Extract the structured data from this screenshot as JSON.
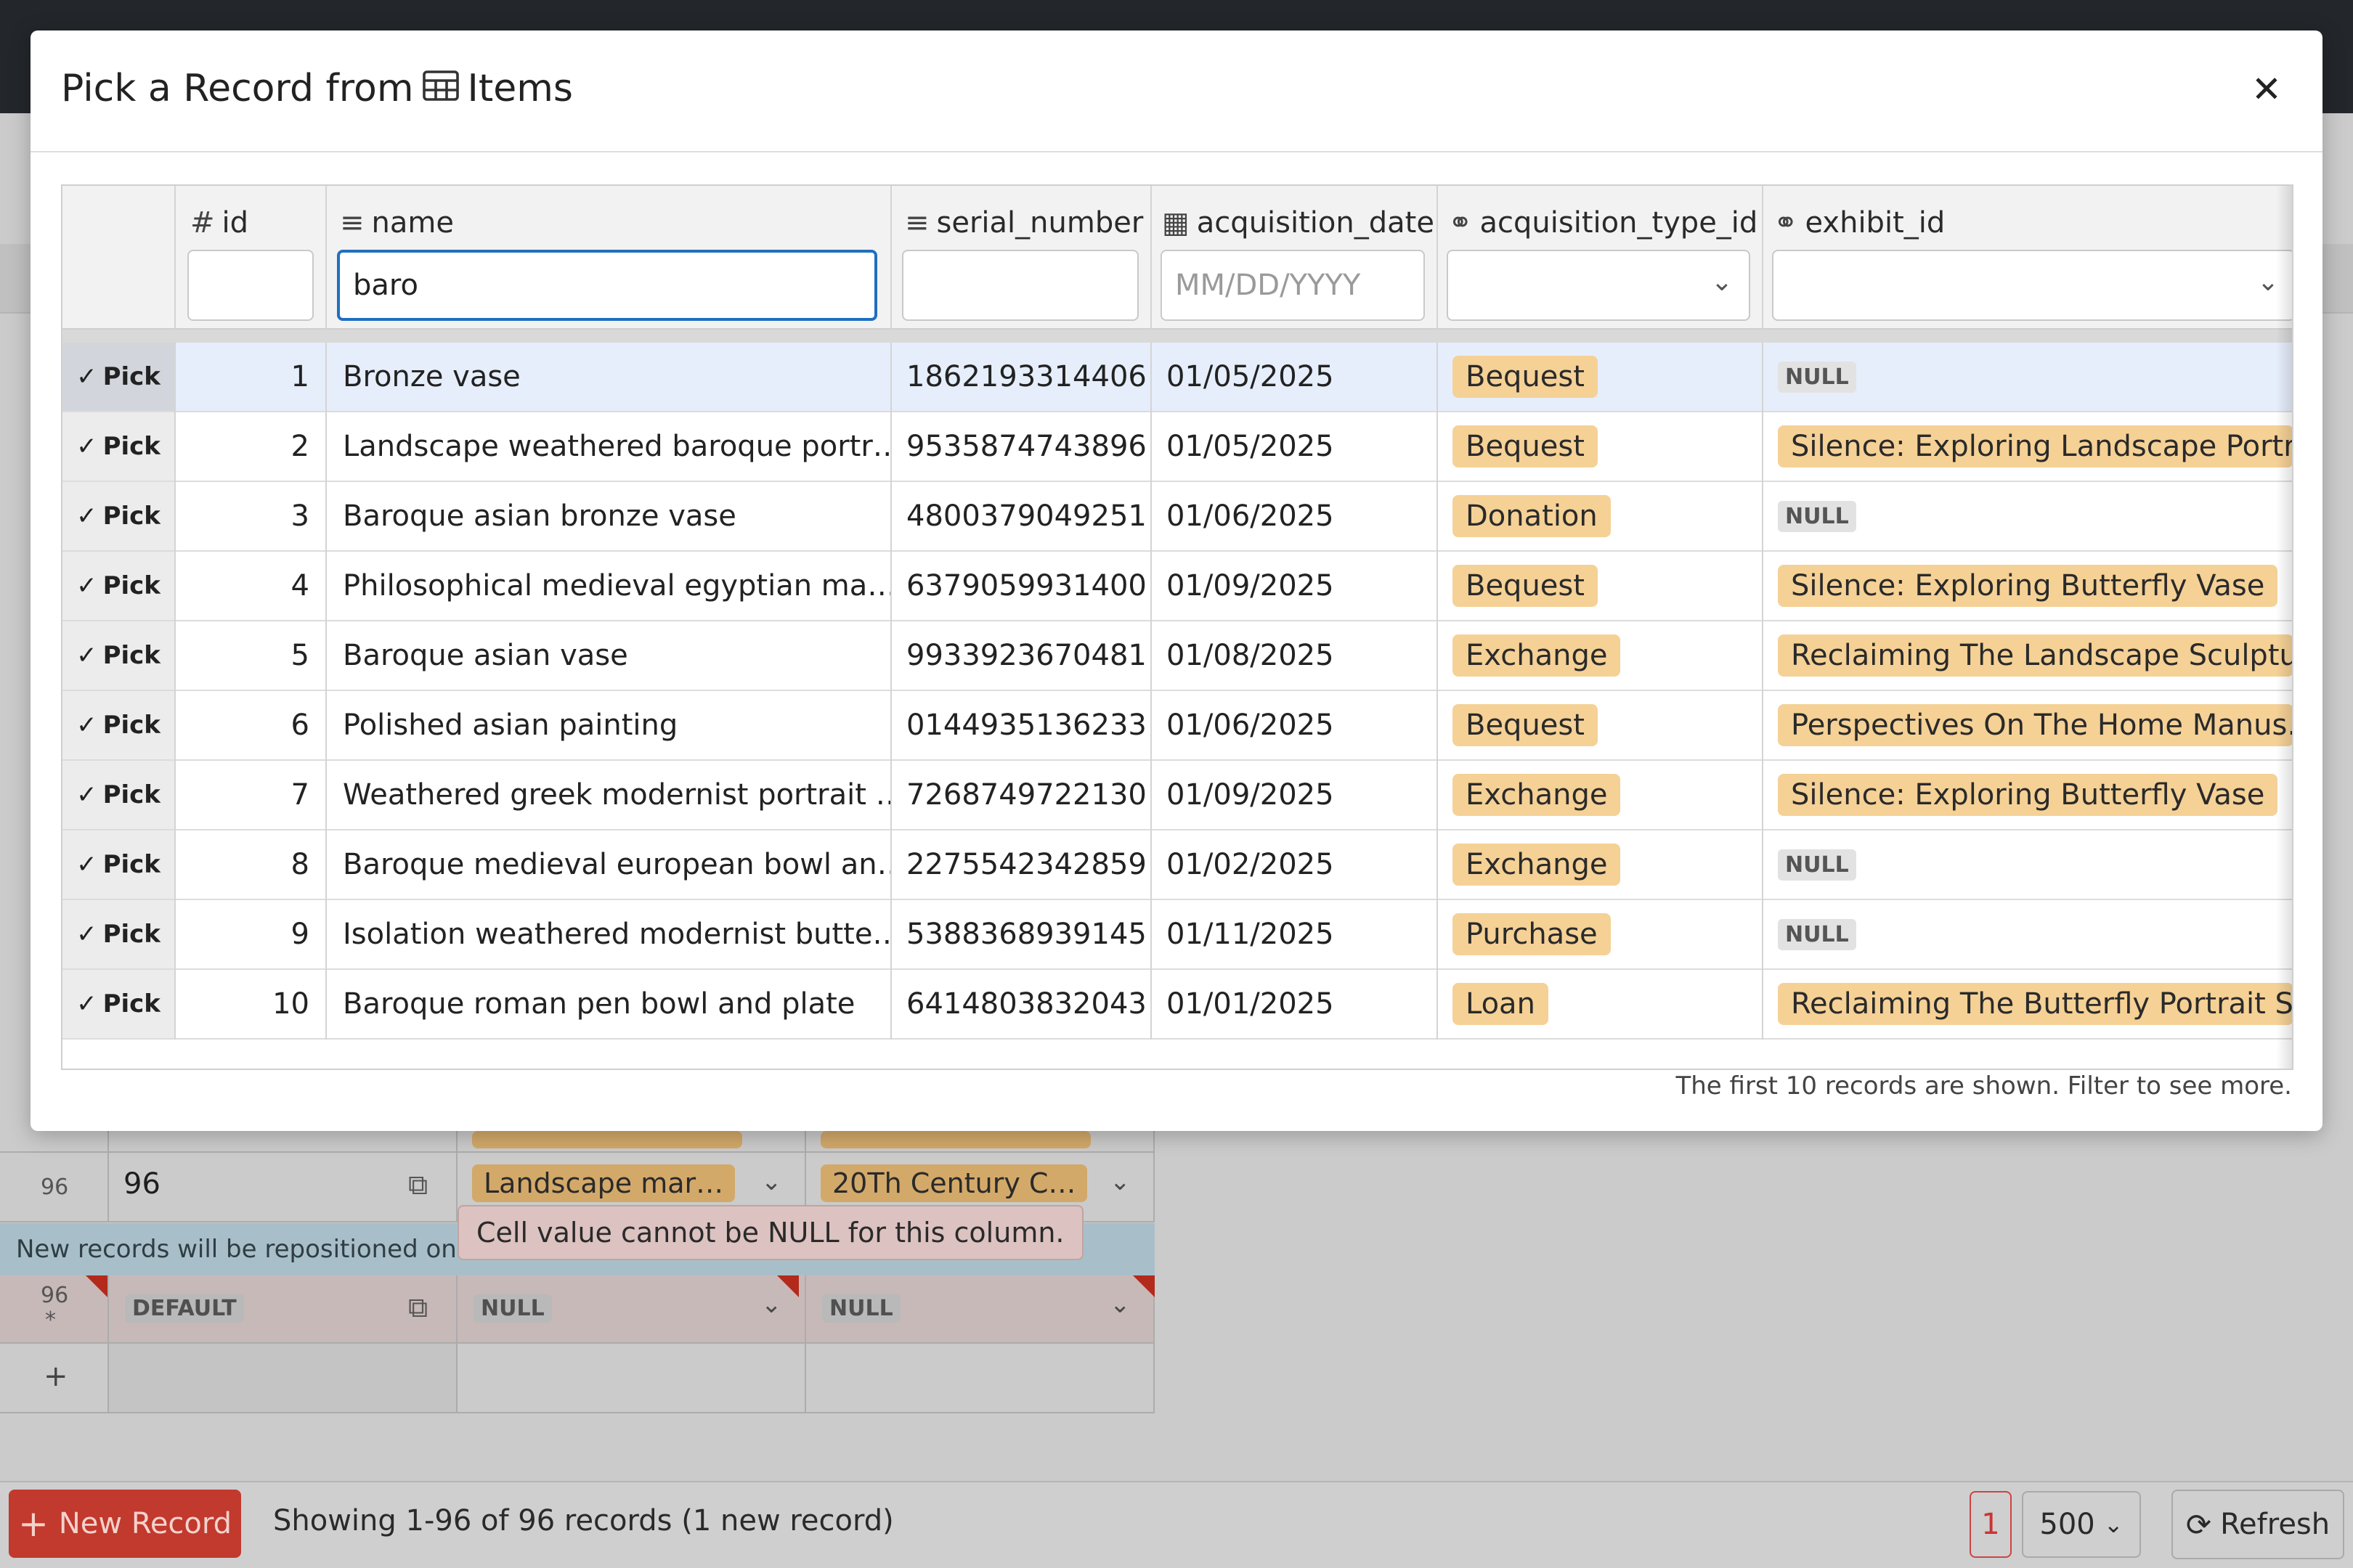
{
  "modal": {
    "title_prefix": "Pick a Record from",
    "table_name": "Items",
    "close_glyph": "✕",
    "note": "The first 10 records are shown. Filter to see more."
  },
  "columns": [
    {
      "key": "id",
      "label": "id",
      "icon": "hash-icon",
      "glyph": "#"
    },
    {
      "key": "name",
      "label": "name",
      "icon": "text-icon",
      "glyph": "≡"
    },
    {
      "key": "serial_number",
      "label": "serial_number",
      "icon": "text-icon",
      "glyph": "≡"
    },
    {
      "key": "acquisition_date",
      "label": "acquisition_date",
      "icon": "calendar-icon",
      "glyph": "▦"
    },
    {
      "key": "acquisition_type_id",
      "label": "acquisition_type_id",
      "icon": "link-icon",
      "glyph": "⚭"
    },
    {
      "key": "exhibit_id",
      "label": "exhibit_id",
      "icon": "link-icon",
      "glyph": "⚭"
    }
  ],
  "filters": {
    "id": "",
    "name": "baro",
    "serial_number": "",
    "date_placeholder": "MM/DD/YYYY"
  },
  "pick_label": "Pick",
  "null_label": "NULL",
  "rows": [
    {
      "id": "1",
      "name": "Bronze vase",
      "serial": "1862193314406",
      "date": "01/05/2025",
      "acq": "Bequest",
      "exhibit": null,
      "selected": true
    },
    {
      "id": "2",
      "name": "Landscape weathered baroque portr…",
      "serial": "9535874743896",
      "date": "01/05/2025",
      "acq": "Bequest",
      "exhibit": "Silence: Exploring Landscape Portr…"
    },
    {
      "id": "3",
      "name": "Baroque asian bronze vase",
      "serial": "4800379049251",
      "date": "01/06/2025",
      "acq": "Donation",
      "exhibit": null
    },
    {
      "id": "4",
      "name": "Philosophical medieval egyptian ma…",
      "serial": "6379059931400",
      "date": "01/09/2025",
      "acq": "Bequest",
      "exhibit": "Silence: Exploring Butterfly Vase"
    },
    {
      "id": "5",
      "name": "Baroque asian vase",
      "serial": "9933923670481",
      "date": "01/08/2025",
      "acq": "Exchange",
      "exhibit": "Reclaiming The Landscape Sculpture"
    },
    {
      "id": "6",
      "name": "Polished asian painting",
      "serial": "0144935136233",
      "date": "01/06/2025",
      "acq": "Bequest",
      "exhibit": "Perspectives On The Home Manus…"
    },
    {
      "id": "7",
      "name": "Weathered greek modernist portrait …",
      "serial": "7268749722130",
      "date": "01/09/2025",
      "acq": "Exchange",
      "exhibit": "Silence: Exploring Butterfly Vase"
    },
    {
      "id": "8",
      "name": "Baroque medieval european bowl an…",
      "serial": "2275542342859",
      "date": "01/02/2025",
      "acq": "Exchange",
      "exhibit": null
    },
    {
      "id": "9",
      "name": "Isolation weathered modernist butte…",
      "serial": "5388368939145",
      "date": "01/11/2025",
      "acq": "Purchase",
      "exhibit": null
    },
    {
      "id": "10",
      "name": "Baroque roman pen bowl and plate",
      "serial": "6414803832043",
      "date": "01/01/2025",
      "acq": "Loan",
      "exhibit": "Reclaiming The Butterfly Portrait S…"
    }
  ],
  "background": {
    "row96": {
      "num": "96",
      "value": "96",
      "fk1": "Landscape mar…",
      "fk2": "20Th Century C…"
    },
    "new_row": {
      "num": "96",
      "marker": "*",
      "default": "DEFAULT",
      "null1": "NULL",
      "null2": "NULL"
    },
    "add_row_glyph": "+",
    "info_text": "New records will be repositioned on re",
    "tooltip": "Cell value cannot be NULL for this column.",
    "footer": {
      "new_record": "New Record",
      "new_record_glyph": "+",
      "showing": "Showing 1-96 of 96 records (1 new record)",
      "page": "1",
      "page_size": "500",
      "refresh": "Refresh"
    }
  },
  "colors": {
    "accent_blue": "#1f6fbf",
    "pill_bg": "#f5d196",
    "new_record_red": "#c2392d"
  }
}
